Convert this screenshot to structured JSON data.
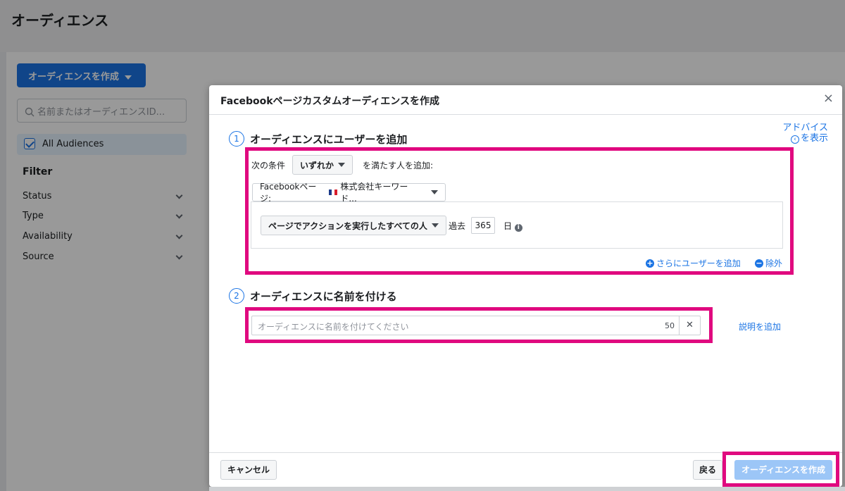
{
  "page": {
    "title": "オーディエンス"
  },
  "toolbar": {
    "create_label": "オーディエンスを作成"
  },
  "search": {
    "placeholder": "名前またはオーディエンスID..."
  },
  "sidebar": {
    "all_audiences": "All Audiences",
    "filter_title": "Filter",
    "filters": [
      {
        "label": "Status"
      },
      {
        "label": "Type"
      },
      {
        "label": "Availability"
      },
      {
        "label": "Source"
      }
    ]
  },
  "dialog": {
    "title": "Facebookページカスタムオーディエンスを作成",
    "close_icon": "×",
    "advice": {
      "line1": "アドバイス",
      "line2": "を表示"
    },
    "step1": {
      "number": "1",
      "title": "オーディエンスにユーザーを追加",
      "condition_prefix": "次の条件",
      "condition_value": "いずれか",
      "condition_suffix": "を満たす人を追加:",
      "source_label": "Facebookページ:",
      "source_value": "株式会社キーワード...",
      "action_value": "ページでアクションを実行したすべての人",
      "past_label": "過去",
      "days_value": "365",
      "days_unit": "日",
      "add_more_link": "さらにユーザーを追加",
      "exclude_link": "除外"
    },
    "step2": {
      "number": "2",
      "title": "オーディエンスに名前を付ける",
      "name_placeholder": "オーディエンスに名前を付けてください",
      "char_count": "50",
      "add_description_link": "説明を追加"
    },
    "footer": {
      "cancel_label": "キャンセル",
      "back_label": "戻る",
      "create_label": "オーディエンスを作成"
    }
  },
  "colors": {
    "accent": "#1b74e4",
    "highlight": "#e0097f",
    "disabled_primary": "#9cc6f7"
  }
}
